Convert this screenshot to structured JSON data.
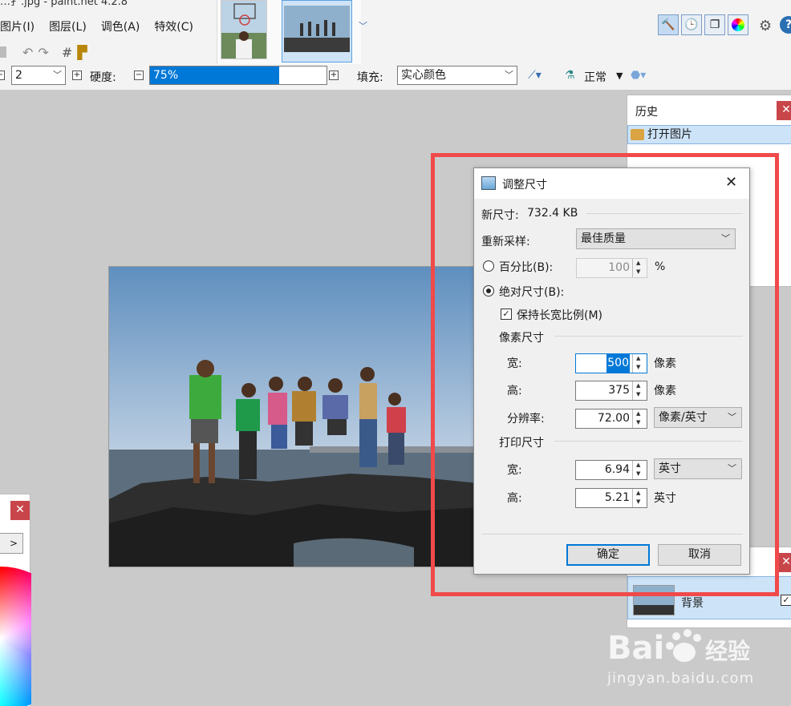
{
  "window": {
    "title_fragment": "…扌.jpg - paint.net 4.2.8"
  },
  "menu": [
    "图片(I)",
    "图层(L)",
    "调色(A)",
    "特效(C)"
  ],
  "toolbar": {
    "brush_width": "2",
    "hardness_label": "硬度:",
    "hardness_value": "75%",
    "hardness_fraction": 0.75,
    "fill_label": "填充:",
    "fill_value": "实心颜色",
    "blend_mode": "正常"
  },
  "panels": {
    "history": {
      "title": "历史",
      "items": [
        "打开图片"
      ]
    },
    "layers": {
      "items": [
        {
          "name": "背景",
          "visible": true
        }
      ]
    },
    "colors": {
      "more_label": ">"
    }
  },
  "dialog": {
    "title": "调整尺寸",
    "new_size_label": "新尺寸:",
    "new_size_value": "732.4 KB",
    "resample_label": "重新采样:",
    "resample_value": "最佳质量",
    "by_percentage_label": "百分比(B):",
    "percentage_value": "100",
    "percent_unit": "%",
    "by_absolute_label": "绝对尺寸(B):",
    "maintain_aspect_label": "保持长宽比例(M)",
    "pixel_size_label": "像素尺寸",
    "width_label": "宽:",
    "height_label": "高:",
    "resolution_label": "分辨率:",
    "pixel_width": "500",
    "pixel_height": "375",
    "pixel_unit": "像素",
    "resolution_value": "72.00",
    "resolution_unit": "像素/英寸",
    "print_size_label": "打印尺寸",
    "print_width": "6.94",
    "print_height": "5.21",
    "print_unit_select": "英寸",
    "print_unit": "英寸",
    "ok_label": "确定",
    "cancel_label": "取消"
  },
  "watermark": {
    "logo": "Bai du 经验",
    "url": "jingyan.baidu.com"
  },
  "colors": {
    "highlight_red": "#f04a4a",
    "accent_blue": "#0078d7",
    "selection_blue": "#cde3f7"
  }
}
